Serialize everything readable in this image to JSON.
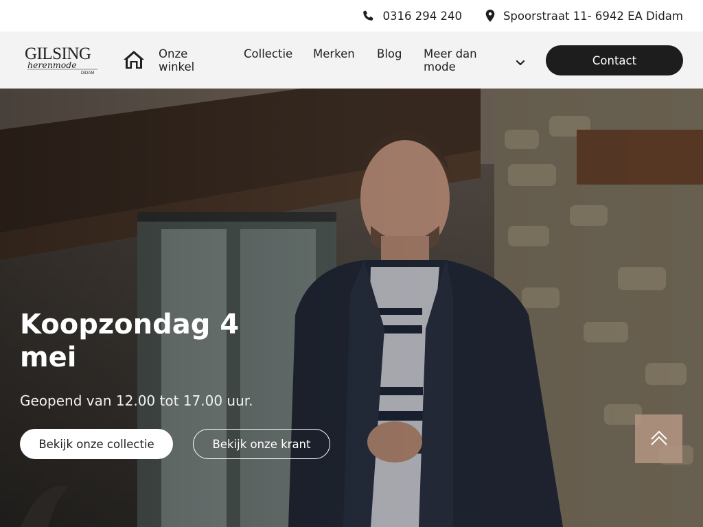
{
  "topbar": {
    "phone": "0316 294 240",
    "phone_icon": "phone-icon",
    "address": "Spoorstraat 11- 6942 EA Didam",
    "address_icon": "map-pin-icon"
  },
  "header": {
    "logo": {
      "name": "GILSING",
      "tagline": "herenmode",
      "place": "DIDAM"
    },
    "home_icon": "home-icon",
    "nav": {
      "onze_winkel": "Onze winkel",
      "collectie": "Collectie",
      "merken": "Merken",
      "blog": "Blog",
      "meer_dan_mode": "Meer dan mode",
      "dropdown_icon": "chevron-down-icon"
    },
    "contact_label": "Contact"
  },
  "hero": {
    "title": "Koopzondag 4 mei",
    "subtitle": "Geopend van 12.00 tot 17.00 uur.",
    "primary_button": "Bekijk onze collectie",
    "secondary_button": "Bekijk onze krant",
    "scroll_top_icon": "double-chevron-up-icon"
  },
  "colors": {
    "dark": "#1d1d1d",
    "header_bg": "#f3f3f3",
    "scroll_top_bg": "#b49682"
  }
}
